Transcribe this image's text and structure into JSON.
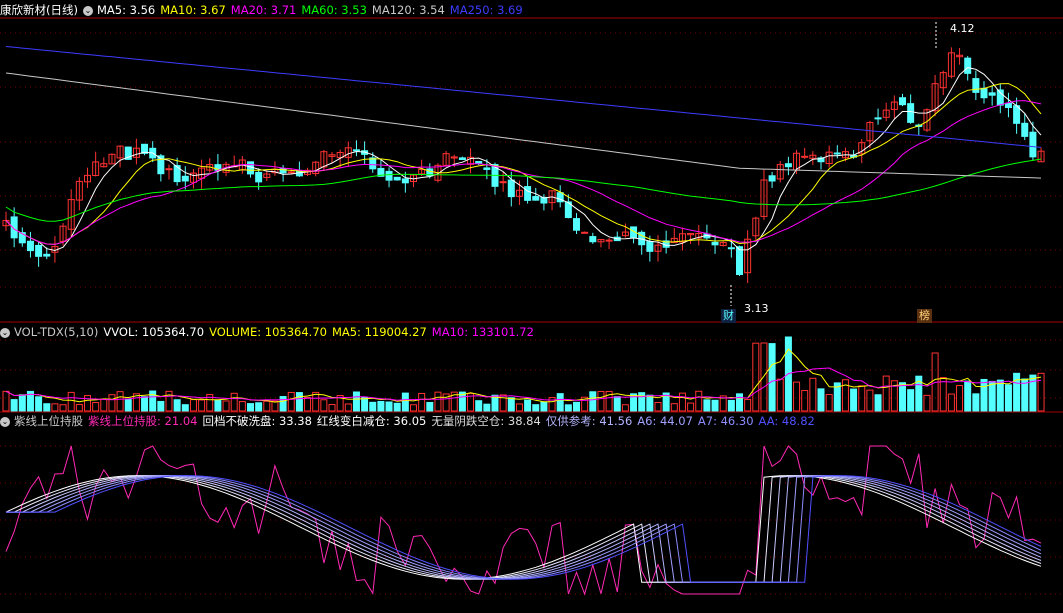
{
  "colors": {
    "bg": "#000000",
    "up": "#ff3232",
    "down": "#54ffff",
    "ma5": "#ffffff",
    "ma10": "#ffff00",
    "ma20": "#ff00ff",
    "ma60": "#00ff00",
    "ma120": "#c8c8c8",
    "ma250": "#3c3cff",
    "pink": "#ff2ab4",
    "grid": "#7a0000",
    "sep": "#a00000"
  },
  "main": {
    "title": "康欣新材(日线)",
    "ma_items": [
      {
        "label": "MA5: 3.56",
        "color": "#ffffff"
      },
      {
        "label": "MA10: 3.67",
        "color": "#ffff00"
      },
      {
        "label": "MA20: 3.71",
        "color": "#ff00ff"
      },
      {
        "label": "MA60: 3.53",
        "color": "#00ff00"
      },
      {
        "label": "MA120: 3.54",
        "color": "#c8c8c8"
      },
      {
        "label": "MA250: 3.69",
        "color": "#3c3cff"
      }
    ],
    "high_label": "4.12",
    "low_label": "3.13",
    "badge_cai": "财",
    "badge_bang": "榜"
  },
  "volume": {
    "items": [
      {
        "label": "VOL-TDX(5,10)",
        "color": "#c8c8c8"
      },
      {
        "label": "VVOL: 105364.70",
        "color": "#ffffff"
      },
      {
        "label": "VOLUME: 105364.70",
        "color": "#ffff00"
      },
      {
        "label": "MA5: 119004.27",
        "color": "#ffff00"
      },
      {
        "label": "MA10: 133101.72",
        "color": "#ff00ff"
      }
    ]
  },
  "indicator": {
    "items": [
      {
        "label": "紫线上位持股",
        "color": "#c8c8c8"
      },
      {
        "label": "紫线上位持股: 21.04",
        "color": "#ff2ab4"
      },
      {
        "label": "回档不破洗盘: 33.38",
        "color": "#ffffff"
      },
      {
        "label": "红线变白减仓: 36.05",
        "color": "#ffffff"
      },
      {
        "label": "无量阴跌空仓: 38.84",
        "color": "#dcdcdc"
      },
      {
        "label": "仅供参考: 41.56",
        "color": "#b4b4ff"
      },
      {
        "label": "A6: 44.07",
        "color": "#a0a0ff"
      },
      {
        "label": "A7: 46.30",
        "color": "#8c8cff"
      },
      {
        "label": "AA: 48.82",
        "color": "#5050ff"
      }
    ]
  }
}
